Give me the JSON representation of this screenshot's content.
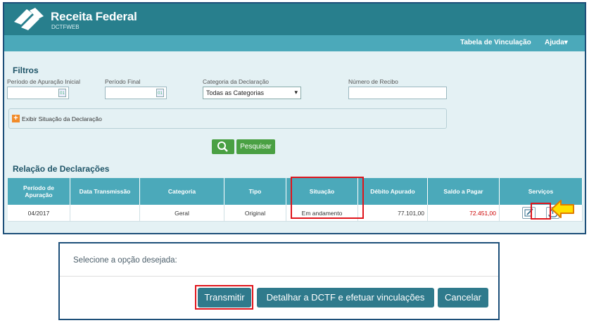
{
  "header": {
    "brand_title": "Receita Federal",
    "brand_sub": "DCTFWEB"
  },
  "nav": {
    "link1": "Tabela de Vinculação",
    "link2": "Ajuda▾"
  },
  "filters": {
    "title": "Filtros",
    "periodo_inicial_label": "Período de Apuração Inicial",
    "periodo_final_label": "Período Final",
    "categoria_label": "Categoria da Declaração",
    "categoria_value": "Todas as Categorias",
    "recibo_label": "Número de Recibo",
    "calendar_glyph": "01",
    "expand_label": "Exibir Situação da Declaração",
    "search_button": "Pesquisar"
  },
  "declarations": {
    "title": "Relação de Declarações",
    "columns": [
      "Período de Apuração",
      "Data Transmissão",
      "Categoria",
      "Tipo",
      "Situação",
      "Débito Apurado",
      "Saldo a Pagar",
      "Serviços"
    ],
    "rows": [
      {
        "periodo": "04/2017",
        "data": "",
        "categoria": "Geral",
        "tipo": "Original",
        "situacao": "Em andamento",
        "debito": "77.101,00",
        "saldo": "72.451,00"
      }
    ]
  },
  "modal": {
    "title": "Selecione a opção desejada:",
    "btn_transmitir": "Transmitir",
    "btn_detalhar": "Detalhar a DCTF e efetuar vinculações",
    "btn_cancelar": "Cancelar"
  },
  "colors": {
    "header": "#287f8d",
    "nav": "#4ba9ba",
    "content_bg": "#e4f1f4",
    "highlight": "#e0141b",
    "saldo": "#cc0000",
    "button_green": "#4aa043",
    "modal_button": "#2f7a8c",
    "arrow_yellow": "#ffe000"
  },
  "icons": [
    "logo-icon",
    "calendar-icon",
    "plus-icon",
    "search-icon",
    "edit-icon",
    "upload-icon",
    "pointer-arrow-icon"
  ]
}
